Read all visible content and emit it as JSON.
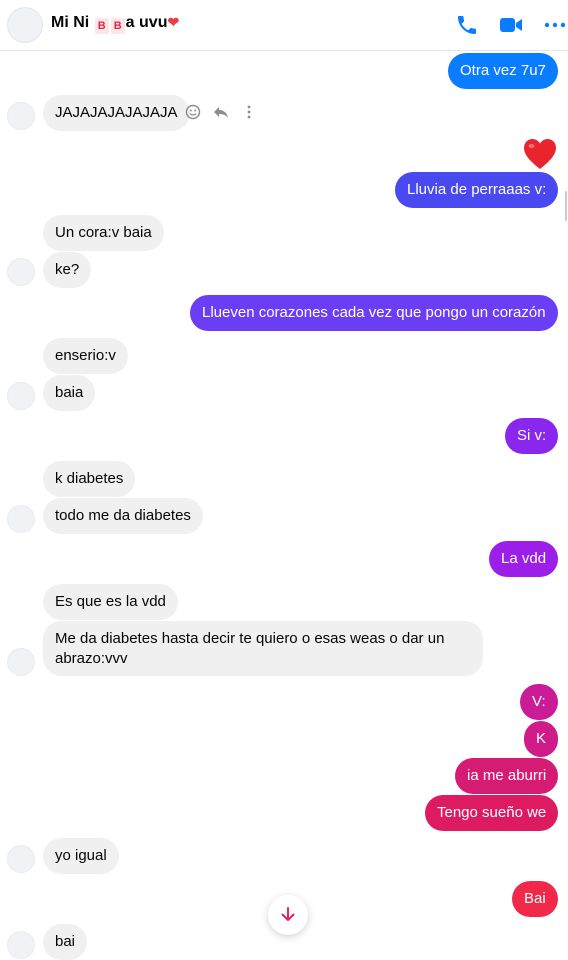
{
  "header": {
    "title_prefix": "Mi Ni",
    "badge1": "B",
    "badge2": "B",
    "title_suffix": "a uvu",
    "heart": "❤"
  },
  "colors": {
    "blue": "#0a7cff",
    "violet": "#6b3ef5",
    "purple": "#9b1fe8",
    "magenta": "#c91c96",
    "pink": "#de1b61",
    "red": "#f02849"
  },
  "messages": [
    {
      "dir": "out",
      "text": "Otra vez 7u7"
    },
    {
      "dir": "in",
      "text": "JAJAJAJAJAJAJA"
    },
    {
      "dir": "out",
      "text": "Lluvia de perraaas v:"
    },
    {
      "dir": "in",
      "text": "Un cora:v baia"
    },
    {
      "dir": "in",
      "text": "ke?"
    },
    {
      "dir": "out",
      "text": "Llueven corazones cada vez que pongo un corazón"
    },
    {
      "dir": "in",
      "text": "enserio:v"
    },
    {
      "dir": "in",
      "text": "baia"
    },
    {
      "dir": "out",
      "text": "Si v:"
    },
    {
      "dir": "in",
      "text": "k diabetes"
    },
    {
      "dir": "in",
      "text": "todo me da diabetes"
    },
    {
      "dir": "out",
      "text": "La vdd"
    },
    {
      "dir": "in",
      "text": "Es que es la vdd"
    },
    {
      "dir": "in",
      "text_line1": "Me da diabetes hasta decir te quiero o esas weas o dar un",
      "text_line2": "abrazo:vvv"
    },
    {
      "dir": "out",
      "text": "V:"
    },
    {
      "dir": "out",
      "text": "K"
    },
    {
      "dir": "out",
      "text": "ia me aburri"
    },
    {
      "dir": "out",
      "text": "Tengo sueño we"
    },
    {
      "dir": "in",
      "text": "yo igual"
    },
    {
      "dir": "out",
      "text": "Bai"
    },
    {
      "dir": "in",
      "text": "bai"
    }
  ]
}
